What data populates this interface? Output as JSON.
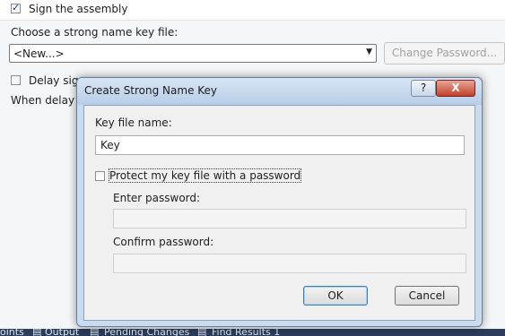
{
  "panel": {
    "sign_assembly_label": "Sign the assembly",
    "choose_key_label": "Choose a strong name key file:",
    "key_combo_value": "<New...>",
    "change_password_label": "Change Password...",
    "delay_sign_label": "Delay sign",
    "delay_sign_note": "When delay s"
  },
  "bottom_tabs": [
    "oints",
    "Output",
    "Pending Changes",
    "Find Results 1"
  ],
  "dialog": {
    "title": "Create Strong Name Key",
    "help_label": "?",
    "close_label": "X",
    "key_file_name_label": "Key file name:",
    "key_file_name_value": "Key",
    "protect_label": "Protect my key file with a password",
    "enter_password_label": "Enter password:",
    "confirm_password_label": "Confirm password:",
    "ok_label": "OK",
    "cancel_label": "Cancel"
  }
}
